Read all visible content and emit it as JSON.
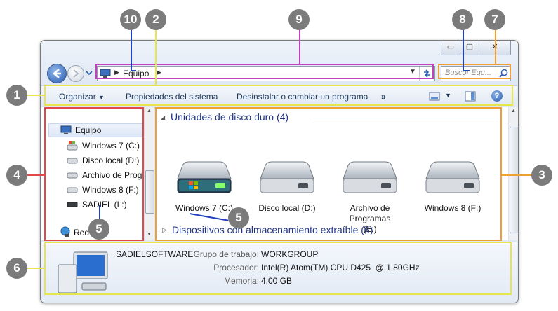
{
  "window": {
    "address": {
      "path": "Equipo"
    },
    "search": {
      "placeholder": "Buscor Equ..."
    },
    "caption_buttons": {
      "minimize": "▭",
      "maximize": "▢",
      "close": "✕"
    }
  },
  "toolbar": {
    "organize": "Organizar",
    "system_properties": "Propiedades del sistema",
    "uninstall": "Desinstalar o cambiar un programa",
    "more": "»"
  },
  "nav": {
    "equipo": "Equipo",
    "items": [
      "Windows 7 (C:)",
      "Disco local (D:)",
      "Archivo de Progr",
      "Windows 8 (F:)",
      "SADIEL (L:)"
    ],
    "red": "Red"
  },
  "content": {
    "hard_drives_header": "Unidades de disco duro (4)",
    "drives": [
      {
        "label": "Windows 7 (C:)"
      },
      {
        "label": "Disco local (D:)"
      },
      {
        "label": "Archivo de Programas (E:)"
      },
      {
        "label": "Windows 8 (F:)"
      }
    ],
    "removable_header": "Dispositivos con almacenamiento extraíble (6)"
  },
  "details": {
    "computer_name": "SADIELSOFTWARE",
    "workgroup_label": "Grupo de trabajo:",
    "workgroup_value": "WORKGROUP",
    "processor_label": "Procesador:",
    "processor_value": "Intel(R) Atom(TM) CPU D425  @ 1.80GHz",
    "memory_label": "Memoria:",
    "memory_value": "4,00 GB"
  },
  "callouts": {
    "c1": "1",
    "c2": "2",
    "c3": "3",
    "c4": "4",
    "c5": "5",
    "c6": "6",
    "c7": "7",
    "c8": "8",
    "c9": "9",
    "c10": "10"
  },
  "colors": {
    "highlight_yellow": "#e6e64a",
    "highlight_red": "#e2474c",
    "highlight_orange": "#f0a030",
    "highlight_purple": "#c040c0",
    "highlight_blue": "#2040c0",
    "callout_gray": "#7b7b7b"
  }
}
